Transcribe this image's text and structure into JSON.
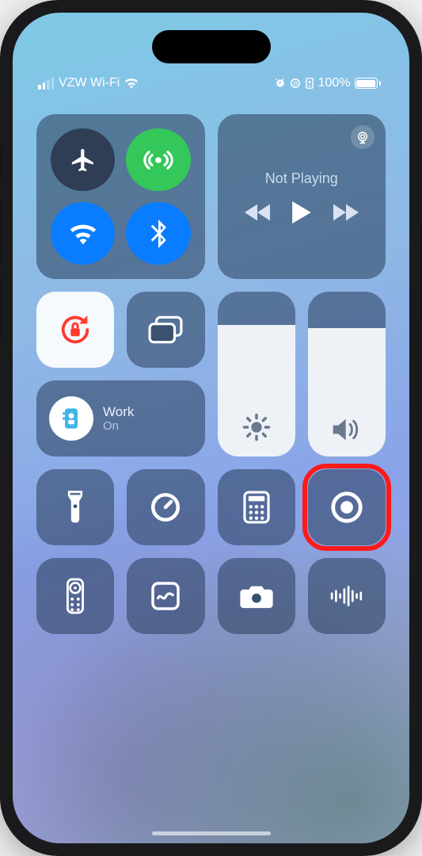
{
  "status": {
    "carrier": "VZW Wi-Fi",
    "battery_pct": "100%"
  },
  "media": {
    "airplay_icon": "airplay-icon",
    "now_playing": "Not Playing"
  },
  "focus": {
    "name": "Work",
    "state": "On"
  },
  "sliders": {
    "brightness_pct": 80,
    "volume_pct": 78
  },
  "colors": {
    "tile": "rgba(40,60,90,.55)",
    "blue": "#0a7cff",
    "green": "#34c759",
    "red": "#ff1a1a",
    "lock": "#ff3b30"
  },
  "iconbar": {
    "row1": [
      "flashlight",
      "timer",
      "calculator",
      "screen-record"
    ],
    "row2": [
      "apple-tv-remote",
      "freeform",
      "camera",
      "voice-memos"
    ]
  },
  "highlight": "screen-record"
}
